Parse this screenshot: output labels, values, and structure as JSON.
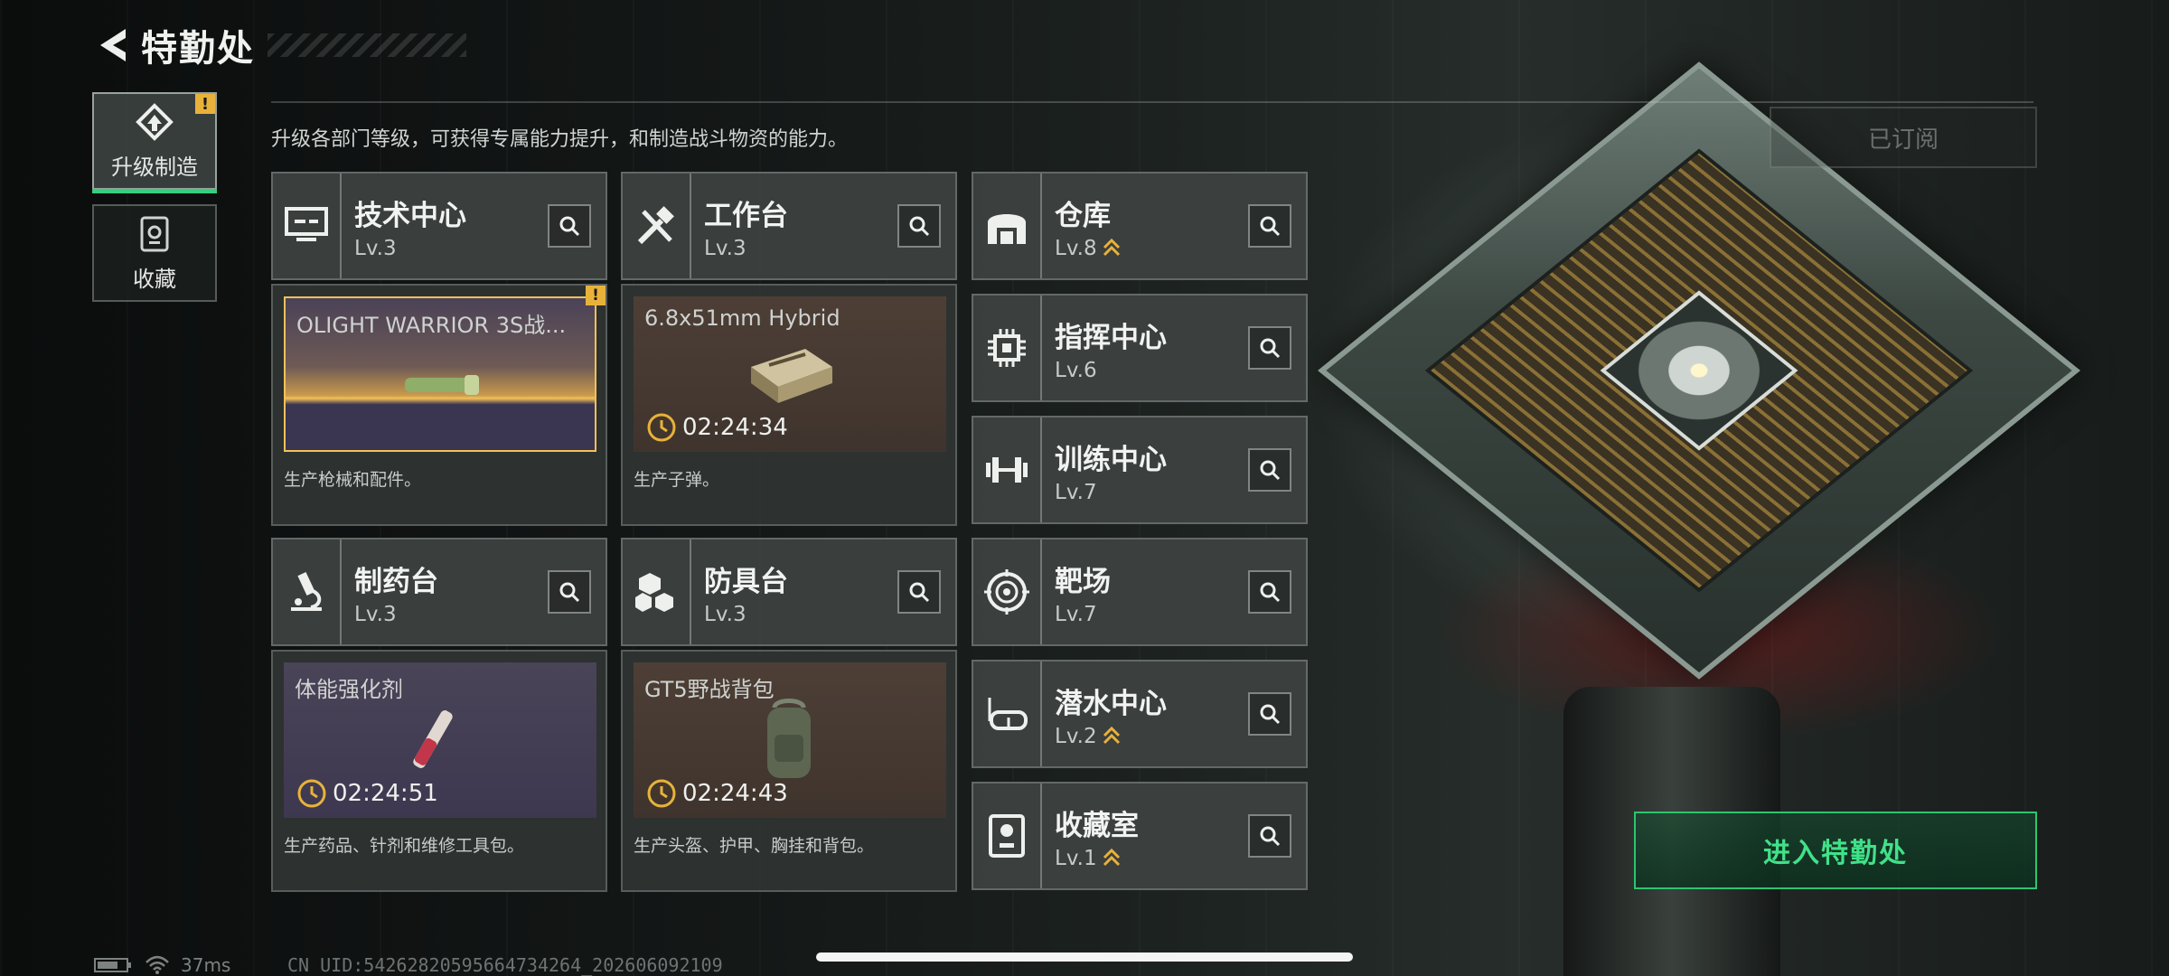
{
  "header": {
    "title": "特勤处"
  },
  "subtitle": "升级各部门等级，可获得专属能力提升，和制造战斗物资的能力。",
  "nav": [
    {
      "label": "升级制造",
      "badge": "!",
      "active": true
    },
    {
      "label": "收藏",
      "active": false
    }
  ],
  "subscribed_label": "已订阅",
  "enter_label": "进入特勤处",
  "departments": {
    "tech_center": {
      "name": "技术中心",
      "level": "Lv.3"
    },
    "workbench": {
      "name": "工作台",
      "level": "Lv.3"
    },
    "warehouse": {
      "name": "仓库",
      "level": "Lv.8"
    },
    "command_center": {
      "name": "指挥中心",
      "level": "Lv.6"
    },
    "training_center": {
      "name": "训练中心",
      "level": "Lv.7"
    },
    "pharmacy": {
      "name": "制药台",
      "level": "Lv.3"
    },
    "armor_bench": {
      "name": "防具台",
      "level": "Lv.3"
    },
    "shooting_range": {
      "name": "靶场",
      "level": "Lv.7"
    },
    "diving_center": {
      "name": "潜水中心",
      "level": "Lv.2"
    },
    "collection_room": {
      "name": "收藏室",
      "level": "Lv.1"
    }
  },
  "production": {
    "tech_center": {
      "item": "OLIGHT WARRIOR 3S战...",
      "badge": "!",
      "desc": "生产枪械和配件。"
    },
    "workbench": {
      "item": "6.8x51mm Hybrid",
      "timer": "02:24:34",
      "desc": "生产子弹。"
    },
    "pharmacy": {
      "item": "体能强化剂",
      "timer": "02:24:51",
      "desc": "生产药品、针剂和维修工具包。"
    },
    "armor_bench": {
      "item": "GT5野战背包",
      "timer": "02:24:43",
      "desc": "生产头盔、护甲、胸挂和背包。"
    }
  },
  "status": {
    "ping": "37ms",
    "uid": "CN UID:54262820595664734264_202606092109"
  },
  "colors": {
    "accent": "#33d07d",
    "badge": "#e8b23a",
    "upgrade_chevron": "#e8b23a"
  }
}
